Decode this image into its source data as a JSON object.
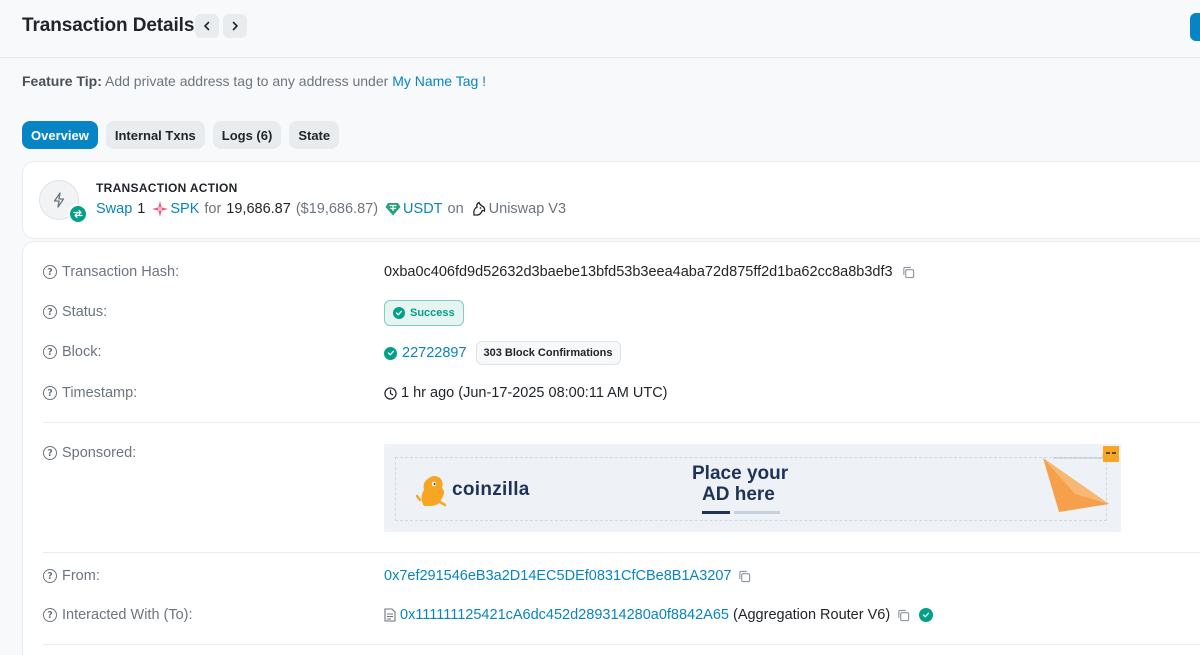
{
  "header": {
    "title": "Transaction Details",
    "prev_icon": "chevron-left-icon",
    "next_icon": "chevron-right-icon"
  },
  "tip": {
    "label": "Feature Tip:",
    "text": "Add private address tag to any address under",
    "link": "My Name Tag !"
  },
  "tabs": [
    {
      "label": "Overview",
      "active": true
    },
    {
      "label": "Internal Txns",
      "active": false
    },
    {
      "label": "Logs (6)",
      "active": false
    },
    {
      "label": "State",
      "active": false
    }
  ],
  "action": {
    "title": "TRANSACTION ACTION",
    "verb": "Swap",
    "amount_in": "1",
    "token_in": "SPK",
    "for_word": "for",
    "amount_out": "19,686.87",
    "amount_out_usd": "($19,686.87)",
    "token_out": "USDT",
    "on_word": "on",
    "dex": "Uniswap V3"
  },
  "details": {
    "hash_label": "Transaction Hash:",
    "hash_value": "0xba0c406fd9d52632d3baebe13bfd53b3eea4aba72d875ff2d1ba62cc8a8b3df3",
    "status_label": "Status:",
    "status_value": "Success",
    "block_label": "Block:",
    "block_value": "22722897",
    "block_confirmations": "303 Block Confirmations",
    "timestamp_label": "Timestamp:",
    "timestamp_value": "1 hr ago (Jun-17-2025 08:00:11 AM UTC)",
    "sponsored_label": "Sponsored:",
    "from_label": "From:",
    "from_value": "0x7ef291546eB3a2D14EC5DEf0831CfCBe8B1A3207",
    "to_label": "Interacted With (To):",
    "to_value": "0x111111125421cA6dc452d289314280a0f8842A65",
    "to_name": "(Aggregation Router V6)"
  },
  "ad": {
    "brand": "coinzilla",
    "line1_a": "Place",
    "line1_b": "your",
    "line2_a": "AD",
    "line2_b": "here"
  },
  "colors": {
    "link": "#0784c3",
    "success": "#00a186",
    "muted": "#6c757d"
  }
}
